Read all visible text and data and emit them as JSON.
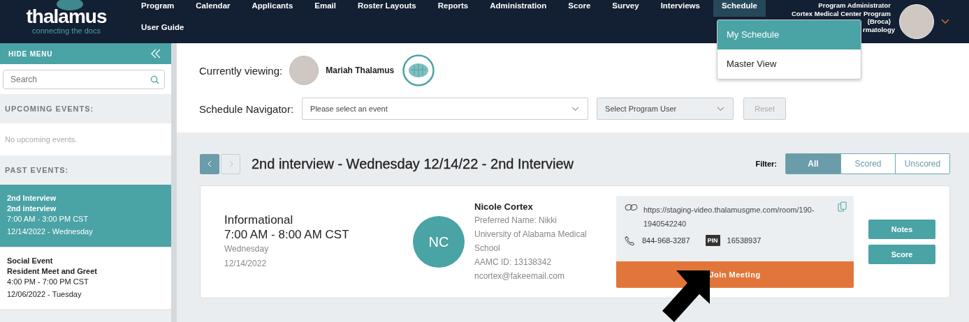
{
  "header": {
    "logo": {
      "name": "thalamus",
      "tagline": "connecting the docs"
    },
    "nav": [
      {
        "label": "Program",
        "selected": false
      },
      {
        "label": "Calendar",
        "selected": false
      },
      {
        "label": "Applicants",
        "selected": false
      },
      {
        "label": "Email",
        "selected": false
      },
      {
        "label": "Roster Layouts",
        "selected": false
      },
      {
        "label": "Reports",
        "selected": false
      },
      {
        "label": "Administration",
        "selected": false
      },
      {
        "label": "Score",
        "selected": false
      },
      {
        "label": "Survey",
        "selected": false
      },
      {
        "label": "Interviews",
        "selected": false
      },
      {
        "label": "Schedule",
        "selected": true
      },
      {
        "label": "User Guide",
        "selected": false
      }
    ],
    "user_lines": [
      "Program Administrator",
      "Cortex Medical Center Program",
      "(Broca)",
      "rmatology"
    ],
    "schedule_menu": [
      {
        "label": "My Schedule",
        "selected": true
      },
      {
        "label": "Master View",
        "selected": false
      }
    ]
  },
  "sidebar": {
    "hide_menu": "HIDE MENU",
    "search": {
      "placeholder": "Search"
    },
    "upcoming": {
      "heading": "UPCOMING EVENTS:",
      "empty": "No upcoming events."
    },
    "past": {
      "heading": "PAST EVENTS:",
      "events": [
        {
          "title": "2nd Interview",
          "subtitle": "2nd interview",
          "time": "7:00 AM - 3:00 PM CST",
          "date": "12/14/2022 - Wednesday",
          "selected": true
        },
        {
          "title": "Social Event",
          "subtitle": "Resident Meet and Greet",
          "time": "4:00 PM - 7:00 PM CST",
          "date": "12/06/2022 - Tuesday",
          "selected": false
        }
      ]
    }
  },
  "viewing": {
    "label": "Currently viewing:",
    "name": "Mariah Thalamus"
  },
  "navigator": {
    "label": "Schedule Navigator:",
    "event_select": {
      "placeholder": "Please select an event"
    },
    "user_select": {
      "placeholder": "Select Program User"
    },
    "reset": {
      "label": "Reset",
      "disabled": true
    }
  },
  "schedule": {
    "title": "2nd interview - Wednesday 12/14/22 - 2nd Interview",
    "filter_label": "Filter:",
    "filters": [
      {
        "label": "All",
        "selected": true
      },
      {
        "label": "Scored",
        "selected": false
      },
      {
        "label": "Unscored",
        "selected": false
      }
    ],
    "interviews": [
      {
        "type": "Informational",
        "time": "7:00 AM - 8:00 AM CST",
        "day": "Wednesday",
        "date": "12/14/2022",
        "initials": "NC",
        "name": "Nicole Cortex",
        "details": [
          "Preferred Name: Nikki",
          "University of Alabama Medical School",
          "AAMC ID: 13138342",
          "ncortex@fakeemail.com"
        ],
        "link": "https://staging-video.thalamusgme.com/room/190-1940542240",
        "phone": "844-968-3287",
        "pin_label": "PIN",
        "pin": "16538937",
        "join": "Join Meeting",
        "actions": [
          "Notes",
          "Score"
        ]
      }
    ]
  }
}
